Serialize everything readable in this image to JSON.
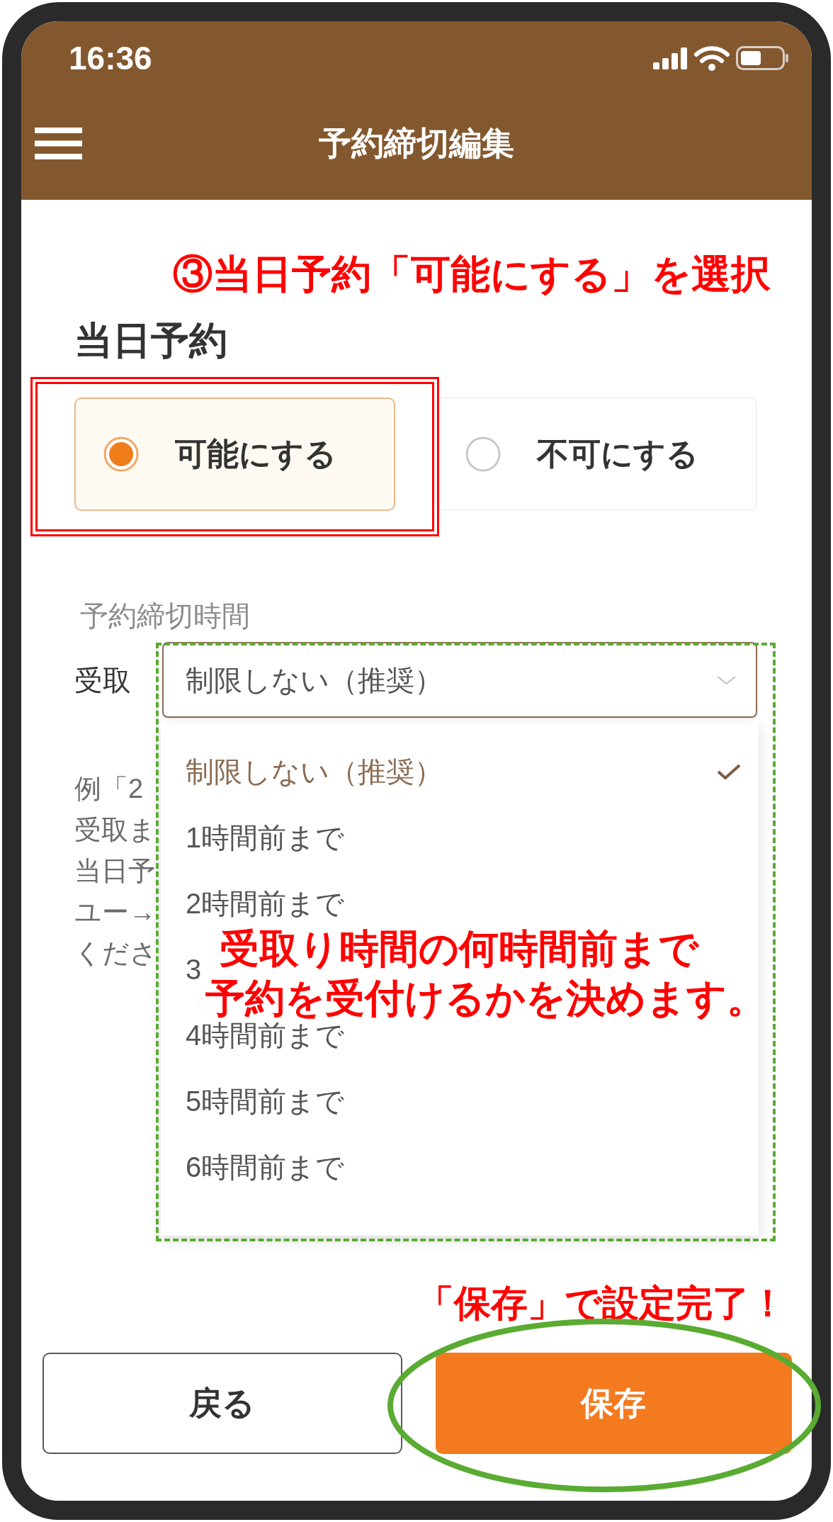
{
  "status_bar": {
    "time": "16:36"
  },
  "header": {
    "title": "予約締切編集"
  },
  "same_day_booking": {
    "heading": "当日予約",
    "options": [
      {
        "label": "可能にする",
        "selected": true
      },
      {
        "label": "不可にする",
        "selected": false
      }
    ]
  },
  "deadline": {
    "label": "予約締切時間",
    "field_label": "受取",
    "value": "制限しない（推奨）",
    "expanded": true,
    "options": [
      {
        "label": "制限しない（推奨）",
        "selected": true
      },
      {
        "label": "1時間前まで",
        "selected": false
      },
      {
        "label": "2時間前まで",
        "selected": false
      },
      {
        "label": "3",
        "selected": false
      },
      {
        "label": "4時間前まで",
        "selected": false
      },
      {
        "label": "5時間前まで",
        "selected": false
      },
      {
        "label": "6時間前まで",
        "selected": false
      }
    ]
  },
  "example_lines": [
    "例「2",
    "受取ま",
    "当日予",
    "ユー→",
    "くださ"
  ],
  "buttons": [
    {
      "kind": "secondary",
      "label": "戻る"
    },
    {
      "kind": "primary",
      "label": "保存"
    }
  ],
  "annotations": {
    "step": "③当日予約「可能にする」を選択",
    "dropdown_note": [
      "受取り時間の何時間前まで",
      "予約を受付けるかを決めます。"
    ],
    "save_note": "「保存」で設定完了！"
  }
}
